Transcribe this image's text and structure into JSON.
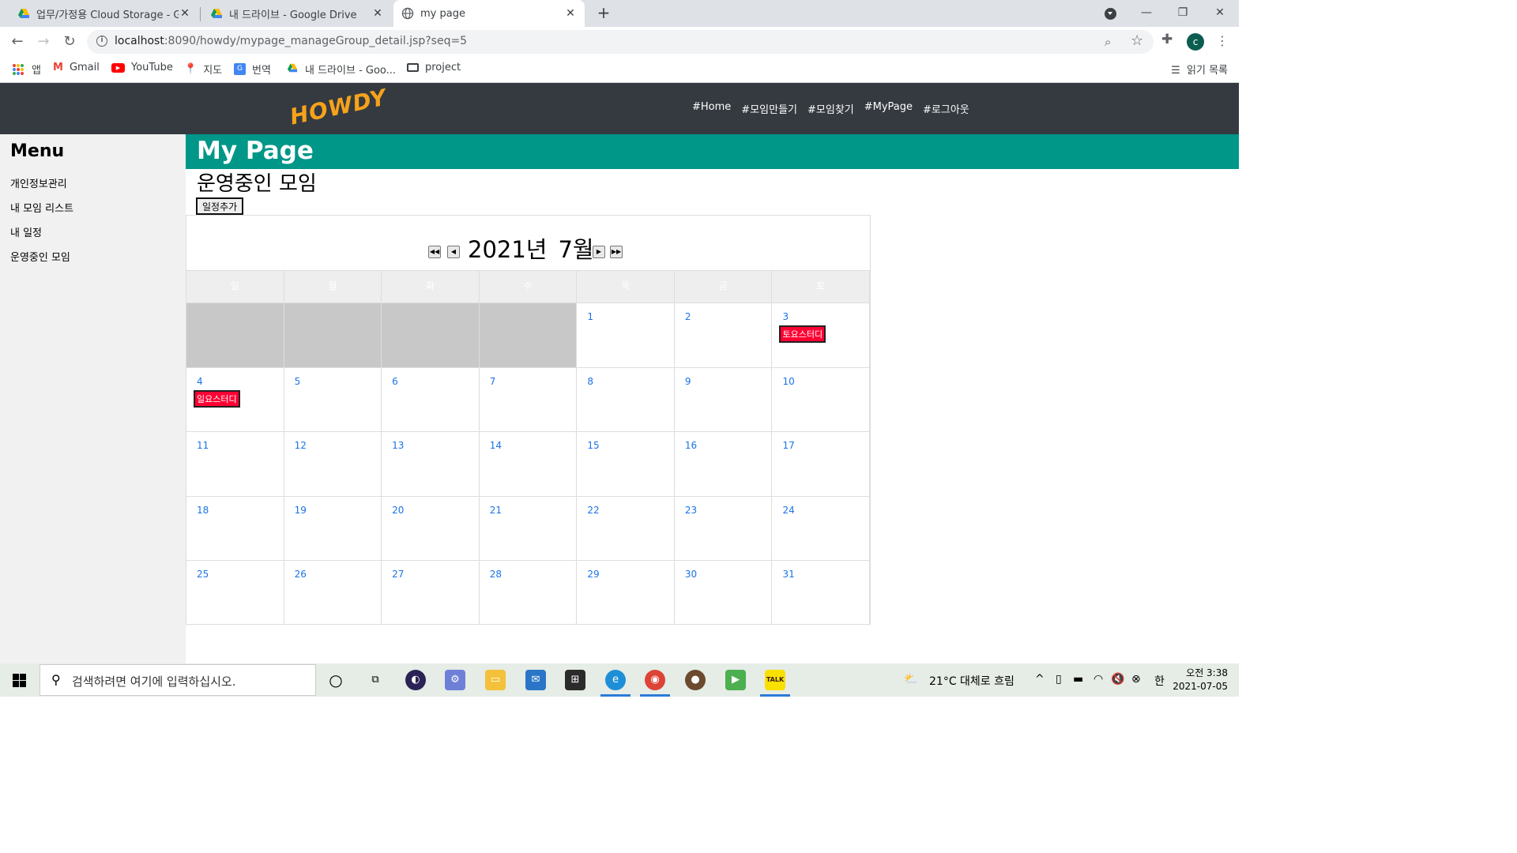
{
  "browser": {
    "tabs": [
      {
        "title": "업무/가정용 Cloud Storage - Go"
      },
      {
        "title": "내 드라이브 - Google Drive"
      },
      {
        "title": "my page"
      }
    ],
    "url_host": "localhost",
    "url_rest": ":8090/howdy/mypage_manageGroup_detail.jsp?seq=5",
    "profile_initial": "c",
    "bookmarks": [
      {
        "label": "앱"
      },
      {
        "label": "Gmail"
      },
      {
        "label": "YouTube"
      },
      {
        "label": "지도"
      },
      {
        "label": "번역"
      },
      {
        "label": "내 드라이브 - Goo..."
      },
      {
        "label": "project"
      }
    ],
    "reading_list": "읽기 목록"
  },
  "site": {
    "logo": "HOWDY",
    "nav": [
      "#Home",
      "#모임만들기",
      "#모임찾기",
      "#MyPage",
      "#로그아웃"
    ]
  },
  "sidebar": {
    "title": "Menu",
    "items": [
      "개인정보관리",
      "내 모임 리스트",
      "내 일정",
      "운영중인 모임"
    ]
  },
  "main": {
    "banner": "My Page",
    "section_title": "운영중인 모임",
    "add_button": "일정추가"
  },
  "calendar": {
    "year_label": "2021년",
    "month_label": "7월",
    "weekdays": [
      "일",
      "월",
      "화",
      "수",
      "목",
      "금",
      "토"
    ],
    "weeks": [
      [
        null,
        null,
        null,
        null,
        {
          "d": "1"
        },
        {
          "d": "2"
        },
        {
          "d": "3",
          "event": "토요스터디"
        }
      ],
      [
        {
          "d": "4",
          "event": "일요스터디"
        },
        {
          "d": "5"
        },
        {
          "d": "6"
        },
        {
          "d": "7"
        },
        {
          "d": "8"
        },
        {
          "d": "9"
        },
        {
          "d": "10"
        }
      ],
      [
        {
          "d": "11"
        },
        {
          "d": "12"
        },
        {
          "d": "13"
        },
        {
          "d": "14"
        },
        {
          "d": "15"
        },
        {
          "d": "16"
        },
        {
          "d": "17"
        }
      ],
      [
        {
          "d": "18"
        },
        {
          "d": "19"
        },
        {
          "d": "20"
        },
        {
          "d": "21"
        },
        {
          "d": "22"
        },
        {
          "d": "23"
        },
        {
          "d": "24"
        }
      ],
      [
        {
          "d": "25"
        },
        {
          "d": "26"
        },
        {
          "d": "27"
        },
        {
          "d": "28"
        },
        {
          "d": "29"
        },
        {
          "d": "30"
        },
        {
          "d": "31"
        }
      ]
    ],
    "event_color": "#ff0033",
    "header_accent": "#009688"
  },
  "taskbar": {
    "search_placeholder": "검색하려면 여기에 입력하십시오.",
    "weather": "21°C  대체로 흐림",
    "ime": "한",
    "time": "오전 3:38",
    "date": "2021-07-05"
  }
}
